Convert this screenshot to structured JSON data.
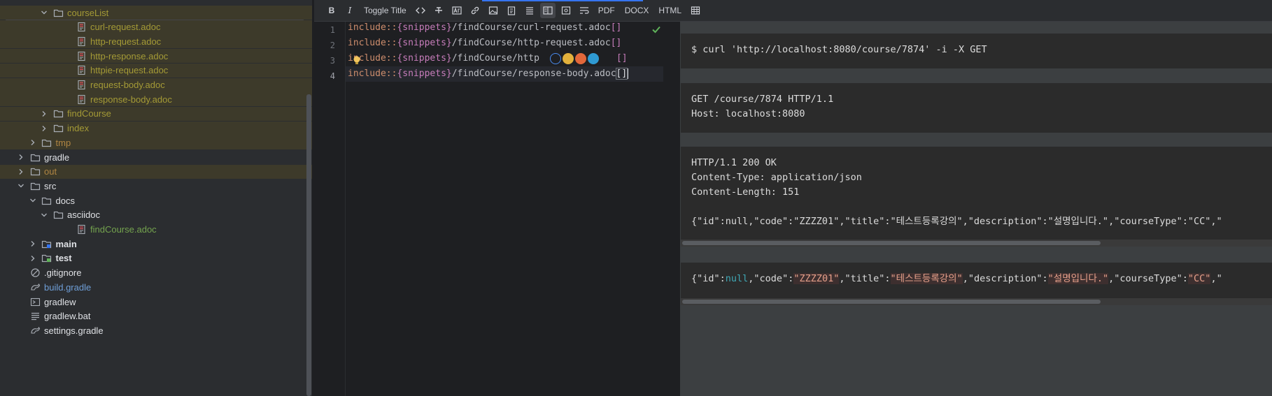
{
  "tree": {
    "items": [
      {
        "label": "courseList",
        "indent": 3,
        "chevron": "down",
        "icon": "folder-icon",
        "color": "olive"
      },
      {
        "label": "curl-request.adoc",
        "indent": 5,
        "chevron": "",
        "icon": "adoc-file-icon",
        "color": "olive"
      },
      {
        "label": "http-request.adoc",
        "indent": 5,
        "chevron": "",
        "icon": "adoc-file-icon",
        "color": "olive"
      },
      {
        "label": "http-response.adoc",
        "indent": 5,
        "chevron": "",
        "icon": "adoc-file-icon",
        "color": "olive"
      },
      {
        "label": "httpie-request.adoc",
        "indent": 5,
        "chevron": "",
        "icon": "adoc-file-icon",
        "color": "olive"
      },
      {
        "label": "request-body.adoc",
        "indent": 5,
        "chevron": "",
        "icon": "adoc-file-icon",
        "color": "olive"
      },
      {
        "label": "response-body.adoc",
        "indent": 5,
        "chevron": "",
        "icon": "adoc-file-icon",
        "color": "olive"
      },
      {
        "label": "findCourse",
        "indent": 3,
        "chevron": "right",
        "icon": "folder-icon",
        "color": "olive"
      },
      {
        "label": "index",
        "indent": 3,
        "chevron": "right",
        "icon": "folder-icon",
        "color": "olive"
      },
      {
        "label": "tmp",
        "indent": 2,
        "chevron": "right",
        "icon": "folder-icon",
        "color": "orange"
      },
      {
        "label": "gradle",
        "indent": 1,
        "chevron": "right",
        "icon": "folder-icon",
        "color": "white"
      },
      {
        "label": "out",
        "indent": 1,
        "chevron": "right",
        "icon": "folder-icon",
        "color": "orange"
      },
      {
        "label": "src",
        "indent": 1,
        "chevron": "down",
        "icon": "folder-icon",
        "color": "white"
      },
      {
        "label": "docs",
        "indent": 2,
        "chevron": "down",
        "icon": "folder-icon",
        "color": "white"
      },
      {
        "label": "asciidoc",
        "indent": 3,
        "chevron": "down",
        "icon": "folder-icon",
        "color": "white"
      },
      {
        "label": "findCourse.adoc",
        "indent": 5,
        "chevron": "",
        "icon": "adoc-file-icon",
        "color": "green"
      },
      {
        "label": "main",
        "indent": 2,
        "chevron": "right",
        "icon": "source-folder-icon",
        "color": "white"
      },
      {
        "label": "test",
        "indent": 2,
        "chevron": "right",
        "icon": "test-folder-icon",
        "color": "white"
      },
      {
        "label": ".gitignore",
        "indent": 1,
        "chevron": "",
        "icon": "ignore-file-icon",
        "color": "white"
      },
      {
        "label": "build.gradle",
        "indent": 1,
        "chevron": "",
        "icon": "gradle-icon",
        "color": "blue"
      },
      {
        "label": "gradlew",
        "indent": 1,
        "chevron": "",
        "icon": "terminal-icon",
        "color": "white"
      },
      {
        "label": "gradlew.bat",
        "indent": 1,
        "chevron": "",
        "icon": "text-file-icon",
        "color": "white"
      },
      {
        "label": "settings.gradle",
        "indent": 1,
        "chevron": "",
        "icon": "gradle-icon",
        "color": "white"
      }
    ]
  },
  "toolbar": {
    "bold": "B",
    "italic": "I",
    "toggle_title": "Toggle Title",
    "pdf": "PDF",
    "docx": "DOCX",
    "html": "HTML"
  },
  "editor": {
    "lines": [
      {
        "num": "1",
        "kw": "include::",
        "attr": "{snippets}",
        "path": "/findCourse/curl-request.adoc",
        "br": "[]"
      },
      {
        "num": "2",
        "kw": "include::",
        "attr": "{snippets}",
        "path": "/findCourse/http-request.adoc",
        "br": "[]"
      },
      {
        "num": "3",
        "kw": "include::",
        "attr": "{snippets}",
        "path": "/findCourse/http",
        "br": "[]"
      },
      {
        "num": "4",
        "kw": "include::",
        "attr": "{snippets}",
        "path": "/findCourse/response-body.adoc",
        "br": "[]"
      }
    ]
  },
  "preview": {
    "curl": "$ curl 'http://localhost:8080/course/7874' -i -X GET",
    "request_line1": "GET /course/7874 HTTP/1.1",
    "request_line2": "Host: localhost:8080",
    "response_line1": "HTTP/1.1 200 OK",
    "response_line2": "Content-Type: application/json",
    "response_line3": "Content-Length: 151",
    "response_body": "{\"id\":null,\"code\":\"ZZZZ01\",\"title\":\"테스트등록강의\",\"description\":\"설명입니다.\",\"courseType\":\"CC\",\"",
    "json": {
      "p1": "{\"id\":",
      "null": "null",
      "p2": ",\"code\":",
      "code": "\"ZZZZ01\"",
      "p3": ",\"title\":",
      "title": "\"테스트등록강의\"",
      "p4": ",\"description\":",
      "description": "\"설명입니다.\"",
      "p5": ",\"courseType\":",
      "courseType": "\"CC\"",
      "p6": ",\""
    }
  }
}
